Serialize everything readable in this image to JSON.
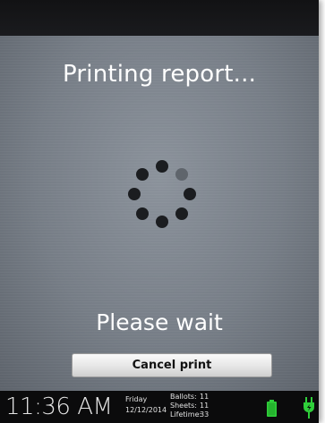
{
  "screen": {
    "title": "Printing report...",
    "wait_message": "Please wait",
    "cancel_label": "Cancel print"
  },
  "status_bar": {
    "time": "11:36 AM",
    "day": "Friday",
    "date": "12/12/2014",
    "counters": [
      {
        "label": "Ballots:",
        "value": "11"
      },
      {
        "label": "Sheets:",
        "value": "11"
      },
      {
        "label": "Lifetime:",
        "value": "33"
      }
    ],
    "battery_icon": "battery-icon",
    "power_icon": "power-plug-icon",
    "accent_color": "#2fcf3a"
  },
  "spinner": {
    "icon": "loading-spinner-icon",
    "dot_color": "#1b1d20",
    "highlight_color": "#5f656c"
  }
}
